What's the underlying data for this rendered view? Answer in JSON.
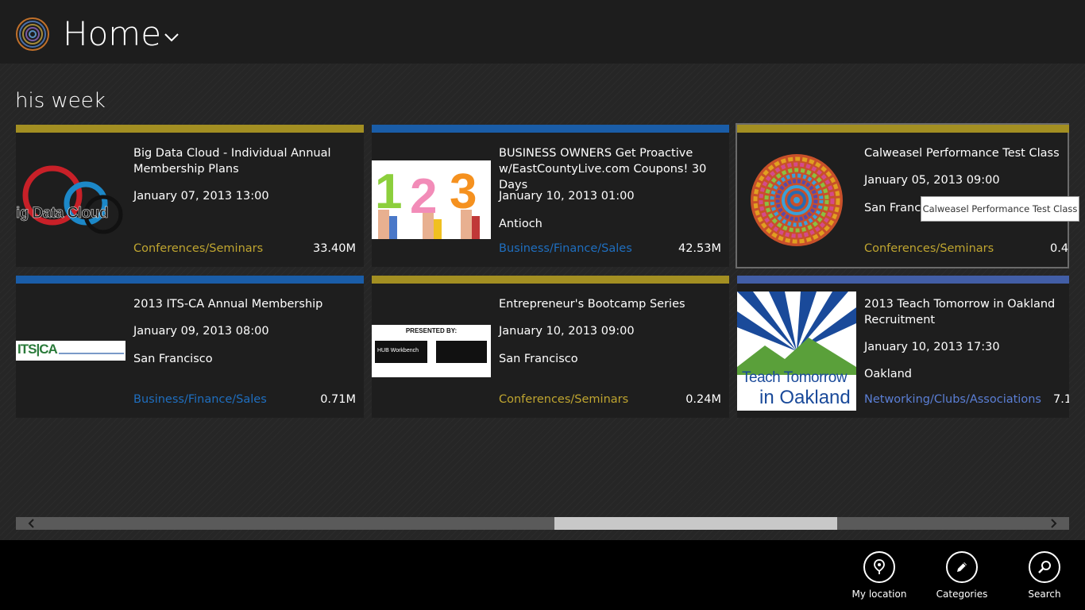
{
  "header": {
    "title": "Home"
  },
  "section": {
    "title": "his week"
  },
  "colors": {
    "olive": "#a38f22",
    "blue": "#1a5da8",
    "slate": "#425ea6",
    "cat_olive": "#bfa530",
    "cat_blue": "#1f6fc0",
    "cat_slate": "#5b7fd6"
  },
  "events": [
    {
      "title": "Big Data Cloud - Individual Annual Membership Plans",
      "date": "January 07, 2013 13:00",
      "location": "",
      "category": "Conferences/Seminars",
      "size": "33.40M",
      "thumb_text": "ig Data Cloud"
    },
    {
      "title": "BUSINESS OWNERS Get Proactive w/EastCountyLive.com Coupons! 30 Days",
      "date": "January 10, 2013 01:00",
      "location": "Antioch",
      "category": "Business/Finance/Sales",
      "size": "42.53M",
      "thumb_text": "123"
    },
    {
      "title": "Calweasel Performance Test Class",
      "date": "January 05, 2013 09:00",
      "location": "San Francis",
      "category": "Conferences/Seminars",
      "size": "0.4",
      "thumb_text": ""
    },
    {
      "title": "2013 ITS-CA Annual Membership",
      "date": "January 09, 2013 08:00",
      "location": "San Francisco",
      "category": "Business/Finance/Sales",
      "size": "0.71M",
      "thumb_text": "ITS|CA"
    },
    {
      "title": "Entrepreneur's Bootcamp Series",
      "date": "January 10, 2013 09:00",
      "location": "San Francisco",
      "category": "Conferences/Seminars",
      "size": "0.24M",
      "thumb_text": "PRESENTED BY:",
      "thumb_sub": "HUB Workbench"
    },
    {
      "title": "2013 Teach Tomorrow in Oakland Recruitment",
      "date": "January 10, 2013 17:30",
      "location": "Oakland",
      "category": "Networking/Clubs/Associations",
      "size": "7.1",
      "thumb_text": "Teach Tomorrow",
      "thumb_sub": "in Oakland"
    }
  ],
  "tooltip": {
    "text": "Calweasel Performance Test Class"
  },
  "appbar": {
    "my_location": "My location",
    "categories": "Categories",
    "search": "Search"
  }
}
